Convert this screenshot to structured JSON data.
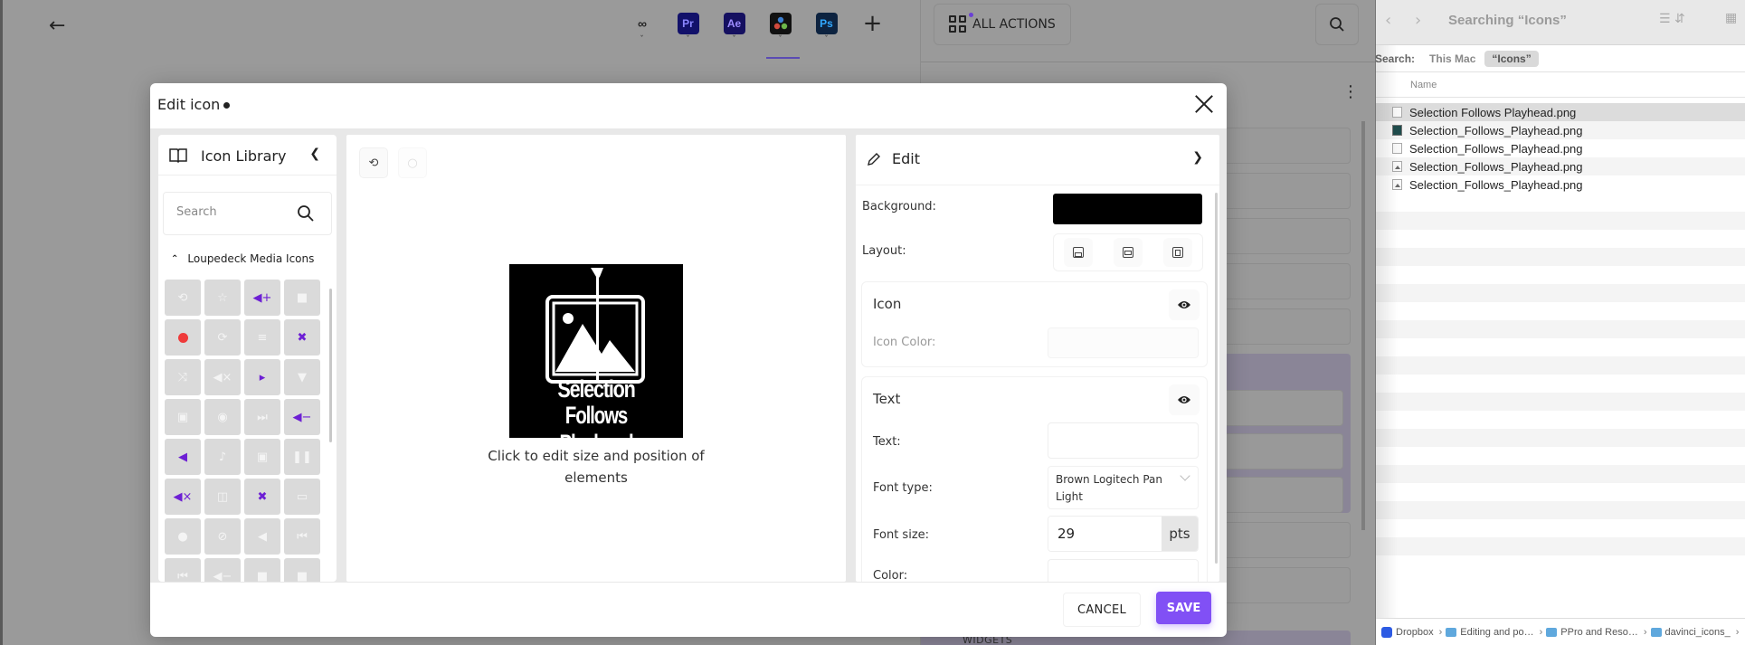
{
  "background_app": {
    "back_icon": "arrow-left-icon",
    "app_tabs": [
      {
        "name": "all-apps",
        "label": "",
        "icon": "grid-icon"
      },
      {
        "name": "premiere-pro",
        "label": "Pr",
        "icon": "premiere-pro-logo"
      },
      {
        "name": "after-effects",
        "label": "Ae",
        "icon": "after-effects-logo"
      },
      {
        "name": "davinci-resolve",
        "label": "",
        "icon": "davinci-resolve-logo",
        "active": true
      },
      {
        "name": "photoshop",
        "label": "Ps",
        "icon": "photoshop-logo"
      }
    ],
    "add_app_label": "+",
    "all_actions_label": "ALL ACTIONS",
    "widgets_label": "WIDGETS",
    "accent_color": "#5b4bb3"
  },
  "finder": {
    "title": "Searching “Icons”",
    "search_label": "Search:",
    "scope_this_mac": "This Mac",
    "scope_query": "“Icons”",
    "column_name": "Name",
    "files": [
      {
        "name": "Selection Follows Playhead.png",
        "icon": "blank",
        "selected": true
      },
      {
        "name": "Selection_Follows_Playhead.png",
        "icon": "teal"
      },
      {
        "name": "Selection_Follows_Playhead.png",
        "icon": "blank"
      },
      {
        "name": "Selection_Follows_Playhead.png",
        "icon": "img"
      },
      {
        "name": "Selection_Follows_Playhead.png",
        "icon": "img"
      }
    ],
    "path": [
      "Dropbox",
      "Editing and po…",
      "PPro and Reso…",
      "davinci_icons_"
    ]
  },
  "modal": {
    "title": "Edit icon",
    "unsaved_indicator": true,
    "library": {
      "title": "Icon Library",
      "search_placeholder": "Search",
      "category": "Loupedeck Media Icons",
      "tiles": [
        {
          "icon": "loop-icon",
          "glyph": "⟲"
        },
        {
          "icon": "star-icon",
          "glyph": "☆"
        },
        {
          "icon": "volume-up-icon",
          "glyph": "◀+",
          "purple": true
        },
        {
          "icon": "thumbs-up-icon",
          "glyph": "■"
        },
        {
          "icon": "record-icon",
          "glyph": "",
          "record": true
        },
        {
          "icon": "repeat-icon",
          "glyph": "⟳"
        },
        {
          "icon": "playlist-icon",
          "glyph": "≡"
        },
        {
          "icon": "mute-mic-icon",
          "glyph": "✖",
          "purple": true
        },
        {
          "icon": "shuffle-icon",
          "glyph": "⤨"
        },
        {
          "icon": "volume-mute-icon",
          "glyph": "◀×"
        },
        {
          "icon": "skip-play-icon",
          "glyph": "▸",
          "purple": true
        },
        {
          "icon": "triangle-down-icon",
          "glyph": "▼"
        },
        {
          "icon": "cast-icon",
          "glyph": "▣"
        },
        {
          "icon": "broadcast-icon",
          "glyph": "◉"
        },
        {
          "icon": "fast-forward-icon",
          "glyph": "⏭"
        },
        {
          "icon": "volume-down-icon",
          "glyph": "◀−",
          "purple": true
        },
        {
          "icon": "volume-toggle-icon",
          "glyph": "◀",
          "purple": true
        },
        {
          "icon": "music-icon",
          "glyph": "♪"
        },
        {
          "icon": "cast-alt-icon",
          "glyph": "▣"
        },
        {
          "icon": "pause-icon",
          "glyph": "❚❚"
        },
        {
          "icon": "mute-icon",
          "glyph": "◀×",
          "purple": true
        },
        {
          "icon": "split-screen-icon",
          "glyph": "◫"
        },
        {
          "icon": "mic-off-icon",
          "glyph": "✖",
          "purple": true
        },
        {
          "icon": "car-icon",
          "glyph": "▭"
        },
        {
          "icon": "microphone-icon",
          "glyph": "●"
        },
        {
          "icon": "microphone-muted-icon",
          "glyph": "⊘"
        },
        {
          "icon": "previous-icon",
          "glyph": "◀"
        },
        {
          "icon": "skip-back-icon",
          "glyph": "⏮"
        },
        {
          "icon": "rewind-icon",
          "glyph": "⏮"
        },
        {
          "icon": "volume-minus-icon",
          "glyph": "◀−"
        },
        {
          "icon": "thumbs-down-icon",
          "glyph": "■"
        },
        {
          "icon": "stop-icon",
          "glyph": "■"
        }
      ]
    },
    "preview": {
      "undo_icon": "undo-icon",
      "redo_icon": "redo-icon",
      "icon_text_line1": "Selection",
      "icon_text_line2": "Follows Playhead",
      "hint": "Click to edit size and position of elements"
    },
    "edit": {
      "title": "Edit",
      "background_label": "Background:",
      "background_color": "#000000",
      "layout_label": "Layout:",
      "icon_section": {
        "title": "Icon",
        "color_label": "Icon Color:"
      },
      "text_section": {
        "title": "Text",
        "text_label": "Text:",
        "text_value": "",
        "font_type_label": "Font type:",
        "font_type_value": "Brown Logitech Pan Light",
        "font_size_label": "Font size:",
        "font_size_value": "29",
        "font_size_unit": "pts",
        "color_label": "Color:"
      }
    },
    "footer": {
      "cancel_label": "CANCEL",
      "save_label": "SAVE",
      "save_color": "#8150f5"
    }
  }
}
